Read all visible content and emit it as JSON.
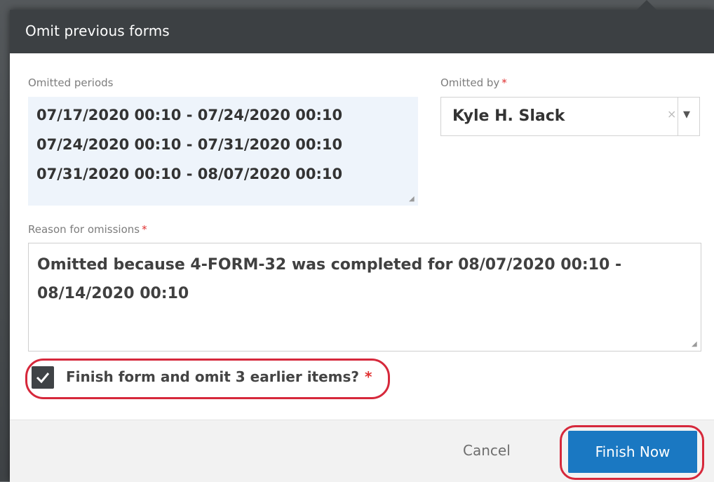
{
  "dialog": {
    "title": "Omit previous forms"
  },
  "omitted_periods": {
    "label": "Omitted periods",
    "periods": [
      "07/17/2020 00:10 - 07/24/2020 00:10",
      "07/24/2020 00:10 - 07/31/2020 00:10",
      "07/31/2020 00:10 - 08/07/2020 00:10"
    ]
  },
  "omitted_by": {
    "label": "Omitted by",
    "required_mark": "*",
    "value": "Kyle H. Slack",
    "clear_glyph": "×",
    "arrow_glyph": "▼",
    "icons": [
      "clear-icon",
      "dropdown-arrow-icon"
    ]
  },
  "reason": {
    "label": "Reason for omissions",
    "required_mark": "*",
    "value": "Omitted because 4-FORM-32 was completed for 08/07/2020 00:10 - 08/14/2020 00:10"
  },
  "confirm": {
    "checked": true,
    "label": "Finish form and omit 3 earlier items?",
    "required_mark": "*",
    "icon": "check-icon"
  },
  "footer": {
    "cancel_label": "Cancel",
    "finish_label": "Finish Now"
  },
  "colors": {
    "header_bg": "#3c4043",
    "periods_bg": "#eef4fb",
    "primary_button": "#1a78c2",
    "required": "#e03030",
    "annotation": "#d6283b"
  }
}
